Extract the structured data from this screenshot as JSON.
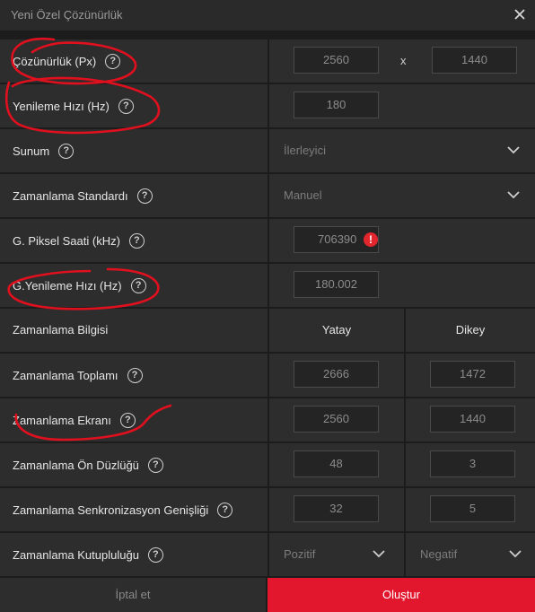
{
  "dialog": {
    "title": "Yeni Özel Çözünürlük",
    "close_icon": "close-icon"
  },
  "rows": {
    "resolution": {
      "label": "Çözünürlük (Px)",
      "width": "2560",
      "separator": "x",
      "height": "1440"
    },
    "refresh": {
      "label": "Yenileme Hızı (Hz)",
      "value": "180"
    },
    "presentation": {
      "label": "Sunum",
      "value": "İlerleyici"
    },
    "timing_standard": {
      "label": "Zamanlama Standardı",
      "value": "Manuel"
    },
    "pixel_clock": {
      "label": "G. Piksel Saati (kHz)",
      "value": "706390"
    },
    "effective_refresh": {
      "label": "G.Yenileme Hızı (Hz)",
      "value": "180.002"
    },
    "timing_info": {
      "label": "Zamanlama Bilgisi",
      "horizontal": "Yatay",
      "vertical": "Dikey"
    },
    "timing_total": {
      "label": "Zamanlama Toplamı",
      "h": "2666",
      "v": "1472"
    },
    "timing_display": {
      "label": "Zamanlama Ekranı",
      "h": "2560",
      "v": "1440"
    },
    "front_porch": {
      "label": "Zamanlama Ön Düzlüğü",
      "h": "48",
      "v": "3"
    },
    "sync_width": {
      "label": "Zamanlama Senkronizasyon Genişliği",
      "h": "32",
      "v": "5"
    },
    "polarity": {
      "label": "Zamanlama Kutupluluğu",
      "h": "Pozitif",
      "v": "Negatif"
    }
  },
  "help_glyph": "?",
  "warning_glyph": "!",
  "buttons": {
    "cancel": "İptal et",
    "create": "Oluştur"
  },
  "colors": {
    "accent": "#e2162d",
    "annotation": "#e0101e"
  }
}
